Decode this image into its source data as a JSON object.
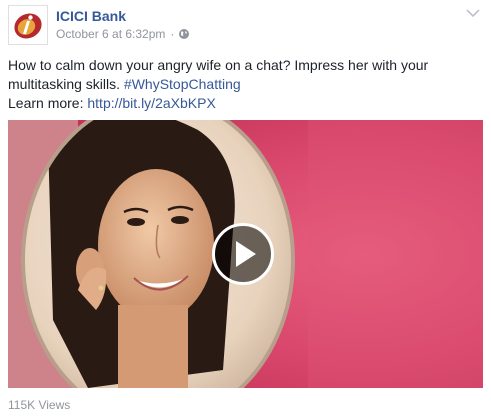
{
  "post": {
    "page_name": "ICICI Bank",
    "timestamp": "October 6 at 6:32pm",
    "separator": "·",
    "privacy_icon": "globe-icon",
    "menu_icon": "chevron-down-icon",
    "text_line1": "How to calm down your angry wife on a chat? Impress her with your multitasking skills.",
    "hashtag": "#WhyStopChatting",
    "learn_more_label": "Learn more:",
    "link": "http://bit.ly/2aXbKPX",
    "views": "115K Views"
  },
  "video": {
    "play_icon": "play-icon"
  },
  "colors": {
    "link": "#365899",
    "meta": "#90949c",
    "brand": "#b5282d",
    "video_bg": "#d8456b"
  }
}
